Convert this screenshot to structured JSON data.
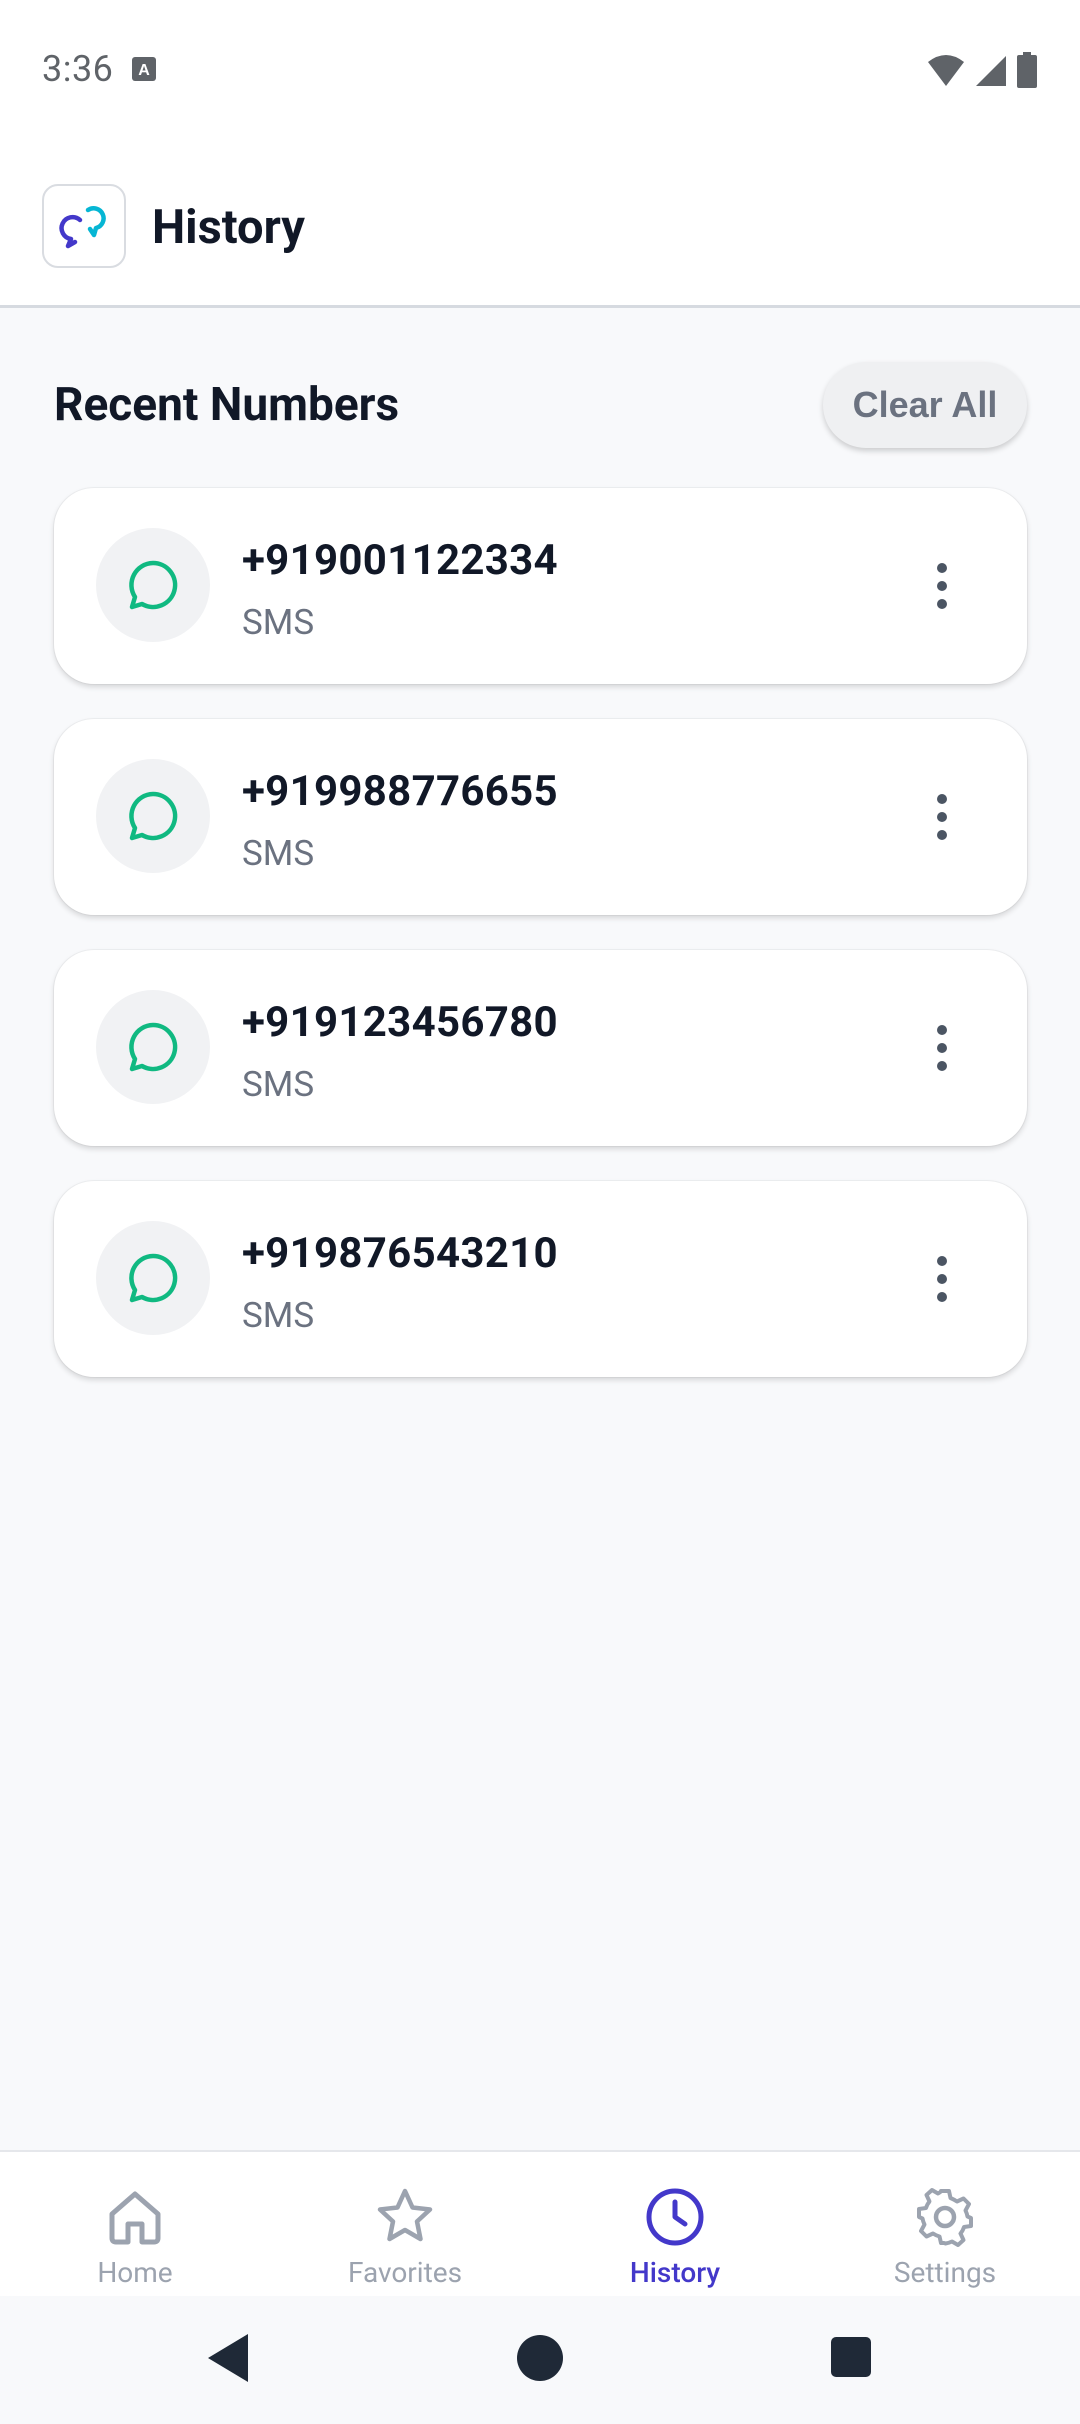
{
  "status_bar": {
    "time": "3:36",
    "icons": [
      "text-a-icon",
      "wifi-icon",
      "signal-icon",
      "battery-icon"
    ]
  },
  "header": {
    "title": "History",
    "logo_icon": "chat-bubbles-logo-icon"
  },
  "section": {
    "title": "Recent Numbers",
    "clear_all_label": "Clear All"
  },
  "history": [
    {
      "number": "+919001122334",
      "type": "SMS",
      "icon": "chat-bubble-icon"
    },
    {
      "number": "+919988776655",
      "type": "SMS",
      "icon": "chat-bubble-icon"
    },
    {
      "number": "+919123456780",
      "type": "SMS",
      "icon": "chat-bubble-icon"
    },
    {
      "number": "+919876543210",
      "type": "SMS",
      "icon": "chat-bubble-icon"
    }
  ],
  "bottom_nav": {
    "items": [
      {
        "label": "Home",
        "icon": "home-icon",
        "active": false
      },
      {
        "label": "Favorites",
        "icon": "star-icon",
        "active": false
      },
      {
        "label": "History",
        "icon": "clock-icon",
        "active": true
      },
      {
        "label": "Settings",
        "icon": "gear-icon",
        "active": false
      }
    ]
  },
  "colors": {
    "accent": "#4338CA",
    "sms_icon": "#10B981",
    "background": "#F8F9FB",
    "text_primary": "#111827",
    "text_secondary": "#6B7280"
  }
}
